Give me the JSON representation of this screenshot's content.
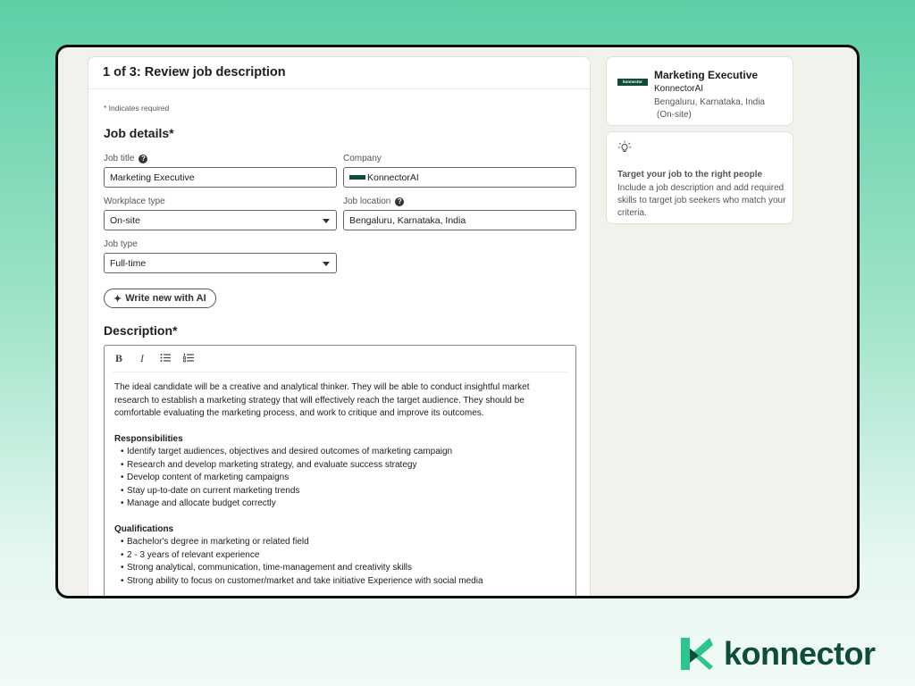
{
  "header": {
    "title": "1 of 3: Review job description"
  },
  "form": {
    "required_note": "* Indicates required",
    "job_details_title": "Job details*",
    "job_title_label": "Job title",
    "job_title_value": "Marketing Executive",
    "company_label": "Company",
    "company_value": "KonnectorAI",
    "workplace_label": "Workplace type",
    "workplace_value": "On-site",
    "location_label": "Job location",
    "location_value": "Bengaluru, Karnataka, India",
    "job_type_label": "Job type",
    "job_type_value": "Full-time",
    "ai_button": "Write new with AI",
    "description_title": "Description*"
  },
  "editor": {
    "toolbar": {
      "bold": "B",
      "italic": "I"
    },
    "intro": "The ideal candidate will be a creative and analytical thinker. They will be able to conduct insightful market research to establish a marketing strategy that will effectively reach the target audience. They should be comfortable evaluating the marketing process, and work to critique and improve its outcomes.",
    "responsibilities_title": "Responsibilities",
    "responsibilities": [
      "Identify target audiences, objectives and desired outcomes of marketing campaign",
      "Research and develop marketing strategy, and evaluate success strategy",
      "Develop content of marketing campaigns",
      "Stay up-to-date on current marketing trends",
      "Manage and allocate budget correctly"
    ],
    "qualifications_title": "Qualifications",
    "qualifications": [
      "Bachelor's degree in marketing or related field",
      "2 - 3 years of relevant experience",
      "Strong analytical, communication, time-management and creativity skills",
      "Strong ability to focus on customer/market and take initiative Experience with social media"
    ]
  },
  "job_summary": {
    "logo_text": "konnector",
    "title": "Marketing Executive",
    "company": "KonnectorAI",
    "location": "Bengaluru, Karnataka, India",
    "workplace": "(On-site)"
  },
  "tip": {
    "title": "Target your job to the right people",
    "text": "Include a job description and add required skills to target job seekers who match your criteria."
  },
  "brand": {
    "name": "konnector",
    "color": "#0e4d3a",
    "accent": "#2ec48e"
  }
}
